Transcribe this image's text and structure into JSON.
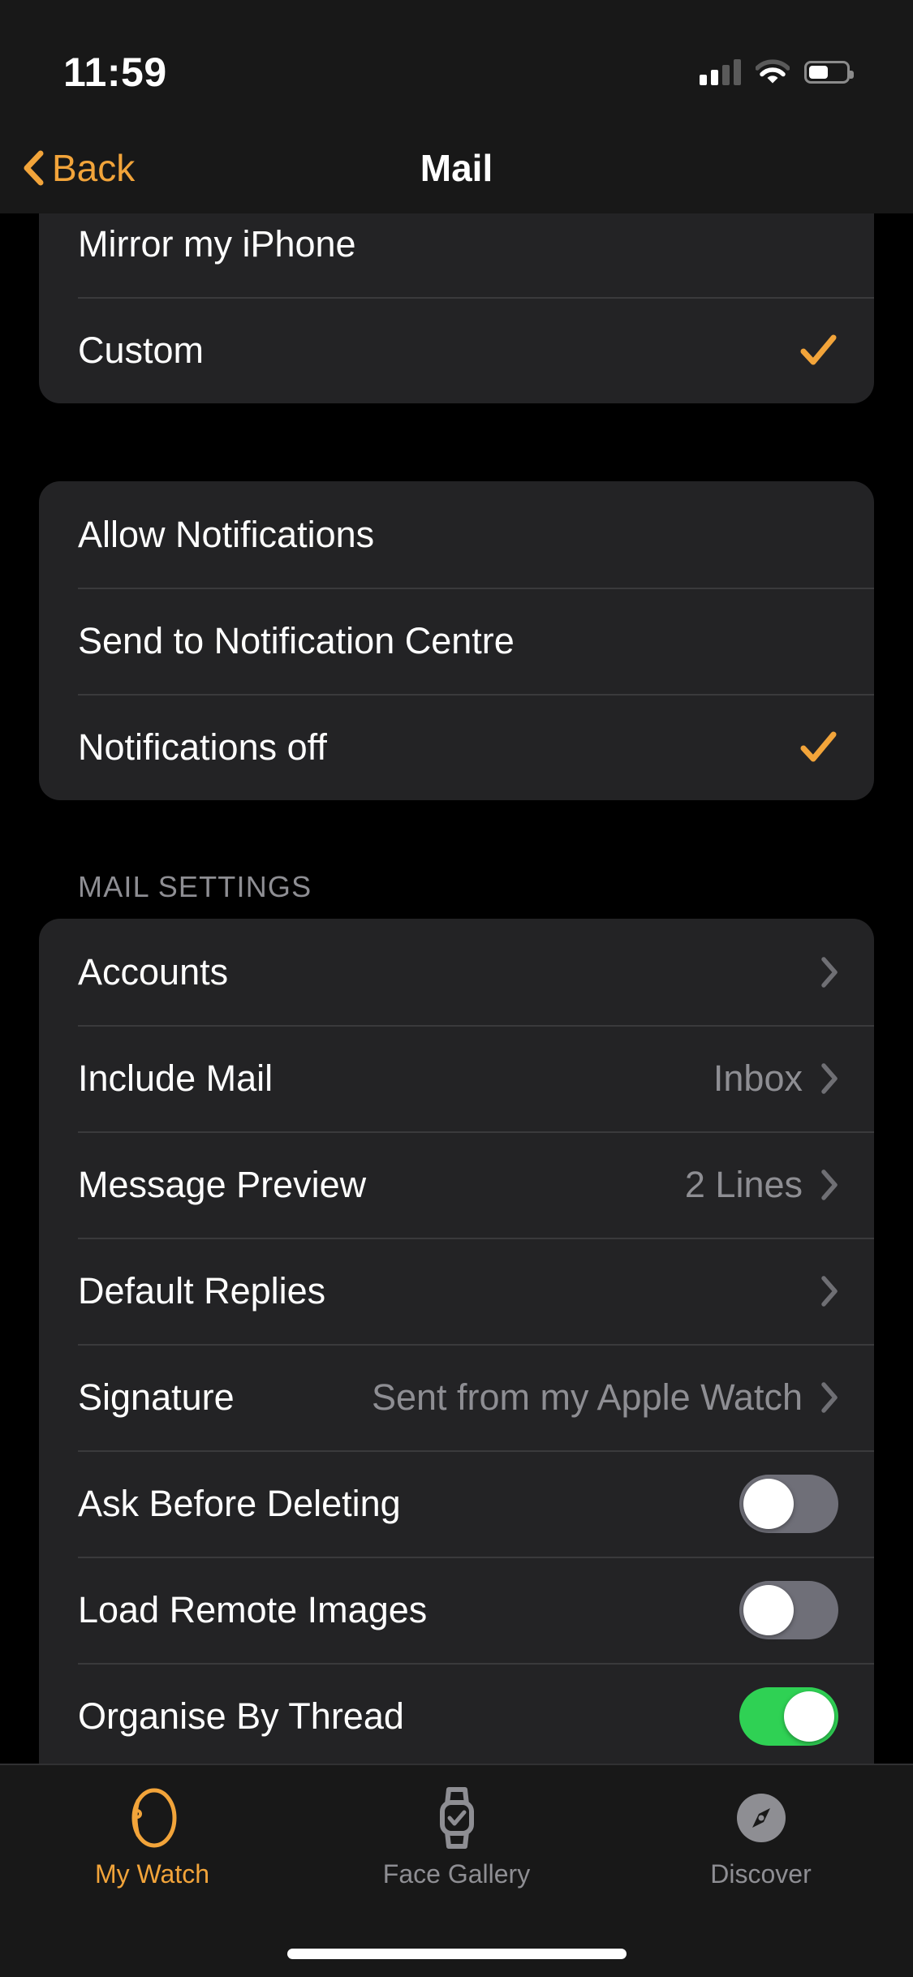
{
  "status_bar": {
    "time": "11:59",
    "signal_icon": "cellular-signal-icon",
    "signal_bars_filled": 2,
    "signal_bars_total": 4,
    "wifi_icon": "wifi-icon",
    "battery_icon": "battery-icon",
    "battery_level_percent": 52
  },
  "nav_bar": {
    "back_label": "Back",
    "back_icon": "chevron-left-icon",
    "title": "Mail"
  },
  "sections": [
    {
      "id": "alert-style-section",
      "header": "",
      "clipped_top": true,
      "rows": [
        {
          "label": "Mirror my iPhone",
          "type": "choice",
          "checked": false
        },
        {
          "label": "Custom",
          "type": "choice",
          "checked": true
        }
      ]
    },
    {
      "id": "notifications-section",
      "header": "",
      "rows": [
        {
          "label": "Allow Notifications",
          "type": "choice",
          "checked": false
        },
        {
          "label": "Send to Notification Centre",
          "type": "choice",
          "checked": false
        },
        {
          "label": "Notifications off",
          "type": "choice",
          "checked": true
        }
      ]
    },
    {
      "id": "mail-settings-section",
      "header": "MAIL SETTINGS",
      "clipped_bottom": true,
      "rows": [
        {
          "label": "Accounts",
          "type": "disclosure",
          "value": ""
        },
        {
          "label": "Include Mail",
          "type": "disclosure",
          "value": "Inbox"
        },
        {
          "label": "Message Preview",
          "type": "disclosure",
          "value": "2 Lines"
        },
        {
          "label": "Default Replies",
          "type": "disclosure",
          "value": ""
        },
        {
          "label": "Signature",
          "type": "disclosure",
          "value": "Sent from my Apple Watch"
        },
        {
          "label": "Ask Before Deleting",
          "type": "toggle",
          "on": false
        },
        {
          "label": "Load Remote Images",
          "type": "toggle",
          "on": false
        },
        {
          "label": "Organise By Thread",
          "type": "toggle",
          "on": true
        }
      ]
    }
  ],
  "tab_bar": {
    "tabs": [
      {
        "label": "My Watch",
        "icon": "watch-side-icon",
        "active": true
      },
      {
        "label": "Face Gallery",
        "icon": "watch-face-icon",
        "active": false
      },
      {
        "label": "Discover",
        "icon": "compass-icon",
        "active": false
      }
    ]
  },
  "colors": {
    "accent": "#f2a43a",
    "toggle_on": "#2fd154",
    "toggle_off": "#6f6f78",
    "card_bg": "#232325",
    "page_bg": "#000000",
    "secondary_text": "#8e8e93"
  }
}
